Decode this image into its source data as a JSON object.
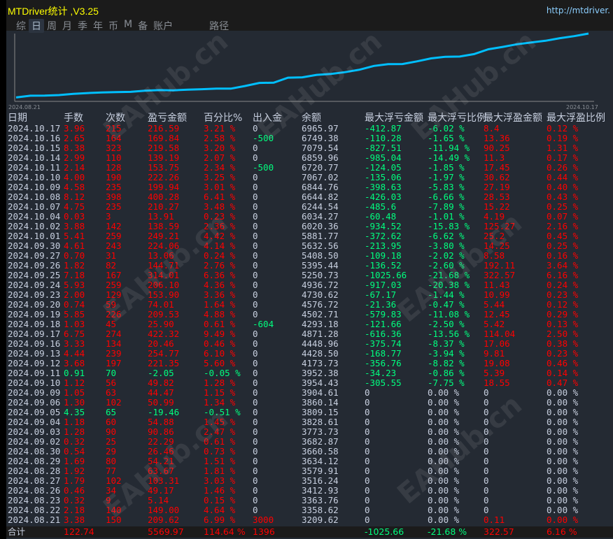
{
  "window": {
    "title": "MTDriver统计 ,V3.25",
    "url": "http://mtdriver."
  },
  "tabs": [
    "综",
    "日",
    "周",
    "月",
    "季",
    "年",
    "币",
    "M",
    "备",
    "账户",
    "路径"
  ],
  "active_tab": "日",
  "chart": {
    "start_label": "2024.08.21",
    "end_label": "2024.10.17",
    "line_color": "#00bfff"
  },
  "watermark": "EAHub.cn",
  "columns": [
    "日期",
    "手数",
    "次数",
    "盈亏金额",
    "百分比%",
    "出入金",
    "余额",
    "最大浮亏金额",
    "最大浮亏比例",
    "最大浮盈金额",
    "最大浮盈比例"
  ],
  "rows": [
    [
      "2024.10.17",
      "3.96",
      "215",
      "216.59",
      "3.21 %",
      "0",
      "6965.97",
      "-412.87",
      "-6.02 %",
      "8.4",
      "0.12 %"
    ],
    [
      "2024.10.16",
      "2.65",
      "164",
      "169.84",
      "2.58 %",
      "-500",
      "6749.38",
      "-110.28",
      "-1.65 %",
      "13.36",
      "0.19 %"
    ],
    [
      "2024.10.15",
      "8.38",
      "323",
      "219.58",
      "3.20 %",
      "0",
      "7079.54",
      "-827.51",
      "-11.94 %",
      "90.25",
      "1.31 %"
    ],
    [
      "2024.10.14",
      "2.99",
      "110",
      "139.19",
      "2.07 %",
      "0",
      "6859.96",
      "-985.04",
      "-14.49 %",
      "11.3",
      "0.17 %"
    ],
    [
      "2024.10.11",
      "2.14",
      "128",
      "153.75",
      "2.34 %",
      "-500",
      "6720.77",
      "-124.05",
      "-1.85 %",
      "17.45",
      "0.26 %"
    ],
    [
      "2024.10.10",
      "4.00",
      "190",
      "222.26",
      "3.25 %",
      "0",
      "7067.02",
      "-135.06",
      "-1.97 %",
      "30.62",
      "0.44 %"
    ],
    [
      "2024.10.09",
      "4.58",
      "235",
      "199.94",
      "3.01 %",
      "0",
      "6844.76",
      "-398.63",
      "-5.83 %",
      "27.19",
      "0.40 %"
    ],
    [
      "2024.10.08",
      "8.12",
      "398",
      "400.28",
      "6.41 %",
      "0",
      "6644.82",
      "-426.03",
      "-6.66 %",
      "28.53",
      "0.43 %"
    ],
    [
      "2024.10.07",
      "4.75",
      "235",
      "210.27",
      "3.48 %",
      "0",
      "6244.54",
      "-485.6",
      "-7.89 %",
      "15.22",
      "0.25 %"
    ],
    [
      "2024.10.04",
      "0.03",
      "3",
      "13.91",
      "0.23 %",
      "0",
      "6034.27",
      "-60.48",
      "-1.01 %",
      "4.19",
      "0.07 %"
    ],
    [
      "2024.10.02",
      "3.88",
      "142",
      "138.59",
      "2.36 %",
      "0",
      "6020.36",
      "-934.52",
      "-15.83 %",
      "125.27",
      "2.16 %"
    ],
    [
      "2024.10.01",
      "5.41",
      "259",
      "249.21",
      "4.42 %",
      "0",
      "5881.77",
      "-372.62",
      "-6.62 %",
      "25.2",
      "0.45 %"
    ],
    [
      "2024.09.30",
      "4.61",
      "243",
      "224.06",
      "4.14 %",
      "0",
      "5632.56",
      "-213.95",
      "-3.80 %",
      "14.25",
      "0.25 %"
    ],
    [
      "2024.09.27",
      "0.70",
      "31",
      "13.06",
      "0.24 %",
      "0",
      "5408.50",
      "-109.18",
      "-2.02 %",
      "8.58",
      "0.16 %"
    ],
    [
      "2024.09.26",
      "1.82",
      "82",
      "144.71",
      "2.76 %",
      "0",
      "5395.44",
      "-136.52",
      "-2.60 %",
      "192.11",
      "3.64 %"
    ],
    [
      "2024.09.25",
      "7.18",
      "167",
      "314.01",
      "6.36 %",
      "0",
      "5250.73",
      "-1025.66",
      "-21.68 %",
      "322.57",
      "6.16 %"
    ],
    [
      "2024.09.24",
      "5.93",
      "259",
      "206.10",
      "4.36 %",
      "0",
      "4936.72",
      "-917.03",
      "-20.38 %",
      "11.43",
      "0.24 %"
    ],
    [
      "2024.09.23",
      "2.00",
      "129",
      "153.90",
      "3.36 %",
      "0",
      "4730.62",
      "-67.17",
      "-1.44 %",
      "10.99",
      "0.23 %"
    ],
    [
      "2024.09.20",
      "0.74",
      "59",
      "74.01",
      "1.64 %",
      "0",
      "4576.72",
      "-21.36",
      "-0.47 %",
      "5.44",
      "0.12 %"
    ],
    [
      "2024.09.19",
      "5.85",
      "226",
      "209.53",
      "4.88 %",
      "0",
      "4502.71",
      "-579.83",
      "-11.08 %",
      "12.45",
      "0.29 %"
    ],
    [
      "2024.09.18",
      "1.03",
      "45",
      "25.90",
      "0.61 %",
      "-604",
      "4293.18",
      "-121.66",
      "-2.50 %",
      "5.42",
      "0.13 %"
    ],
    [
      "2024.09.17",
      "6.75",
      "274",
      "422.32",
      "9.49 %",
      "0",
      "4871.28",
      "-616.36",
      "-13.56 %",
      "114.04",
      "2.50 %"
    ],
    [
      "2024.09.16",
      "3.33",
      "134",
      "20.46",
      "0.46 %",
      "0",
      "4448.96",
      "-375.74",
      "-8.37 %",
      "17.06",
      "0.38 %"
    ],
    [
      "2024.09.13",
      "4.44",
      "239",
      "254.77",
      "6.10 %",
      "0",
      "4428.50",
      "-168.77",
      "-3.94 %",
      "9.81",
      "0.23 %"
    ],
    [
      "2024.09.12",
      "3.68",
      "197",
      "221.35",
      "5.60 %",
      "0",
      "4173.73",
      "-356.76",
      "-8.82 %",
      "19.08",
      "0.46 %"
    ],
    [
      "2024.09.11",
      "0.91",
      "70",
      "-2.05",
      "-0.05 %",
      "0",
      "3952.38",
      "-34.23",
      "-0.86 %",
      "5.39",
      "0.14 %"
    ],
    [
      "2024.09.10",
      "1.12",
      "56",
      "49.82",
      "1.28 %",
      "0",
      "3954.43",
      "-305.55",
      "-7.75 %",
      "18.55",
      "0.47 %"
    ],
    [
      "2024.09.09",
      "1.05",
      "63",
      "44.47",
      "1.15 %",
      "0",
      "3904.61",
      "0",
      "0.00 %",
      "0",
      "0.00 %"
    ],
    [
      "2024.09.06",
      "1.30",
      "102",
      "50.99",
      "1.34 %",
      "0",
      "3860.14",
      "0",
      "0.00 %",
      "0",
      "0.00 %"
    ],
    [
      "2024.09.05",
      "4.35",
      "65",
      "-19.46",
      "-0.51 %",
      "0",
      "3809.15",
      "0",
      "0.00 %",
      "0",
      "0.00 %"
    ],
    [
      "2024.09.04",
      "1.18",
      "60",
      "54.88",
      "1.45 %",
      "0",
      "3828.61",
      "0",
      "0.00 %",
      "0",
      "0.00 %"
    ],
    [
      "2024.09.03",
      "1.28",
      "90",
      "90.86",
      "2.47 %",
      "0",
      "3773.73",
      "0",
      "0.00 %",
      "0",
      "0.00 %"
    ],
    [
      "2024.09.02",
      "0.32",
      "25",
      "22.29",
      "0.61 %",
      "0",
      "3682.87",
      "0",
      "0.00 %",
      "0",
      "0.00 %"
    ],
    [
      "2024.08.30",
      "0.54",
      "29",
      "26.46",
      "0.73 %",
      "0",
      "3660.58",
      "0",
      "0.00 %",
      "0",
      "0.00 %"
    ],
    [
      "2024.08.29",
      "1.69",
      "80",
      "54.21",
      "1.51 %",
      "0",
      "3634.12",
      "0",
      "0.00 %",
      "0",
      "0.00 %"
    ],
    [
      "2024.08.28",
      "1.92",
      "77",
      "63.67",
      "1.81 %",
      "0",
      "3579.91",
      "0",
      "0.00 %",
      "0",
      "0.00 %"
    ],
    [
      "2024.08.27",
      "1.79",
      "102",
      "103.31",
      "3.03 %",
      "0",
      "3516.24",
      "0",
      "0.00 %",
      "0",
      "0.00 %"
    ],
    [
      "2024.08.26",
      "0.46",
      "34",
      "49.17",
      "1.46 %",
      "0",
      "3412.93",
      "0",
      "0.00 %",
      "0",
      "0.00 %"
    ],
    [
      "2024.08.23",
      "0.32",
      "9",
      "5.14",
      "0.15 %",
      "0",
      "3363.76",
      "0",
      "0.00 %",
      "0",
      "0.00 %"
    ],
    [
      "2024.08.22",
      "2.18",
      "140",
      "149.00",
      "4.64 %",
      "0",
      "3358.62",
      "0",
      "0.00 %",
      "0",
      "0.00 %"
    ],
    [
      "2024.08.21",
      "3.38",
      "150",
      "209.62",
      "6.99 %",
      "3000",
      "3209.62",
      "0",
      "0.00 %",
      "0.11",
      "0.00 %"
    ]
  ],
  "total": [
    "合计",
    "122.74",
    "",
    "5569.97",
    "114.64 %",
    "1396",
    "",
    "-1025.66",
    "-21.68 %",
    "322.57",
    "6.16 %"
  ]
}
